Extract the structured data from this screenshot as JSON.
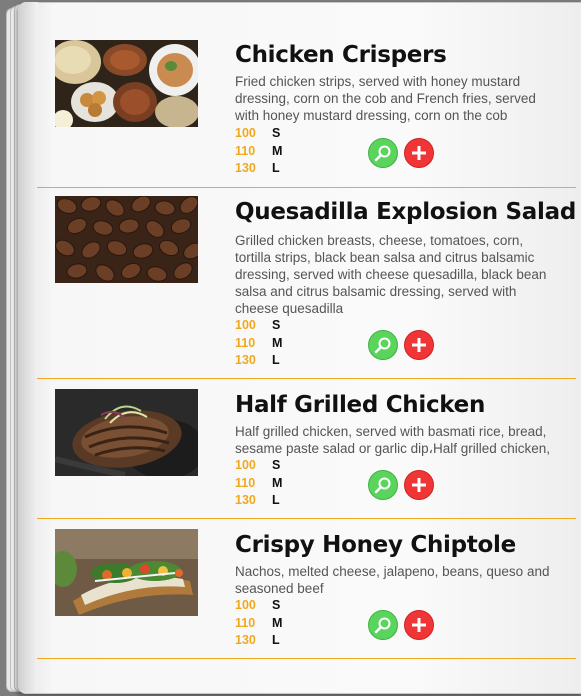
{
  "menu": {
    "items": [
      {
        "title": "Chicken Crispers",
        "description": "Fried chicken strips, served with honey mustard dressing, corn on the cob and French fries, served with honey mustard dressing, corn on the cob",
        "image_icon": "food-platter-photo",
        "prices": [
          {
            "price": "100",
            "size": "S"
          },
          {
            "price": "110",
            "size": "M"
          },
          {
            "price": "130",
            "size": "L"
          }
        ]
      },
      {
        "title": "Quesadilla Explosion Salad",
        "description": "Grilled chicken breasts, cheese, tomatoes, corn, tortilla strips, black bean salsa and citrus balsamic dressing, served with cheese quesadilla, black bean salsa and citrus balsamic dressing, served with cheese quesadilla",
        "image_icon": "coffee-beans-photo",
        "prices": [
          {
            "price": "100",
            "size": "S"
          },
          {
            "price": "110",
            "size": "M"
          },
          {
            "price": "130",
            "size": "L"
          }
        ]
      },
      {
        "title": "Half Grilled Chicken",
        "description": "Half grilled chicken, served with basmati rice, bread, sesame paste salad or garlic dip،Half grilled chicken,",
        "image_icon": "grilled-chicken-photo",
        "prices": [
          {
            "price": "100",
            "size": "S"
          },
          {
            "price": "110",
            "size": "M"
          },
          {
            "price": "130",
            "size": "L"
          }
        ]
      },
      {
        "title": "Crispy Honey Chiptole",
        "description": "Nachos, melted cheese, jalapeno, beans, queso and seasoned beef",
        "image_icon": "open-sandwich-photo",
        "prices": [
          {
            "price": "100",
            "size": "S"
          },
          {
            "price": "110",
            "size": "M"
          },
          {
            "price": "130",
            "size": "L"
          }
        ]
      }
    ],
    "zoom_icon": "magnifier-icon",
    "add_icon": "plus-icon",
    "colors": {
      "accent": "#f0a91e",
      "zoom": "#5bd45e",
      "add": "#ef3535",
      "title": "#111111",
      "description": "#555555"
    }
  }
}
